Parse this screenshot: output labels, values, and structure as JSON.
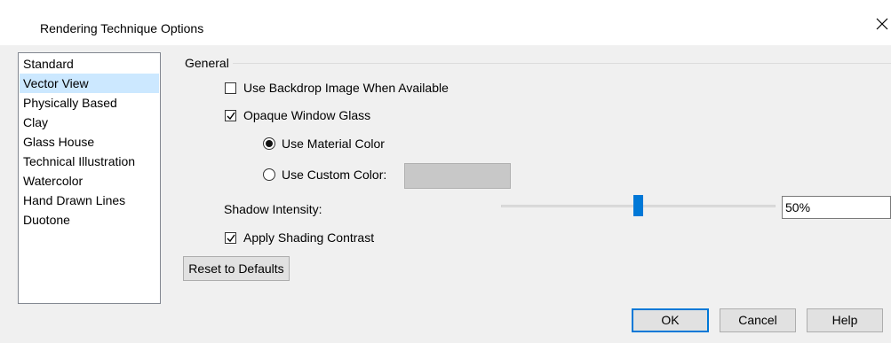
{
  "window": {
    "title": "Rendering Technique Options",
    "close_icon": "close-icon"
  },
  "technique_list": {
    "items": [
      {
        "label": "Standard",
        "selected": false
      },
      {
        "label": "Vector View",
        "selected": true
      },
      {
        "label": "Physically Based",
        "selected": false
      },
      {
        "label": "Clay",
        "selected": false
      },
      {
        "label": "Glass House",
        "selected": false
      },
      {
        "label": "Technical Illustration",
        "selected": false
      },
      {
        "label": "Watercolor",
        "selected": false
      },
      {
        "label": "Hand Drawn Lines",
        "selected": false
      },
      {
        "label": "Duotone",
        "selected": false
      }
    ]
  },
  "general": {
    "group_label": "General",
    "use_backdrop": {
      "label": "Use Backdrop Image When Available",
      "checked": false
    },
    "opaque_glass": {
      "label": "Opaque Window Glass",
      "checked": true
    },
    "material_color": {
      "label": "Use Material Color",
      "selected": true
    },
    "custom_color": {
      "label": "Use Custom Color:",
      "selected": false,
      "swatch": "#c8c8c8"
    },
    "shadow": {
      "label": "Shadow Intensity:",
      "value": "50%",
      "level": 0.5
    },
    "shading_contrast": {
      "label": "Apply Shading Contrast",
      "checked": true
    },
    "reset_label": "Reset to Defaults"
  },
  "footer": {
    "ok_label": "OK",
    "cancel_label": "Cancel",
    "help_label": "Help"
  },
  "colors": {
    "accent": "#0078d7",
    "selection": "#cce8ff"
  }
}
